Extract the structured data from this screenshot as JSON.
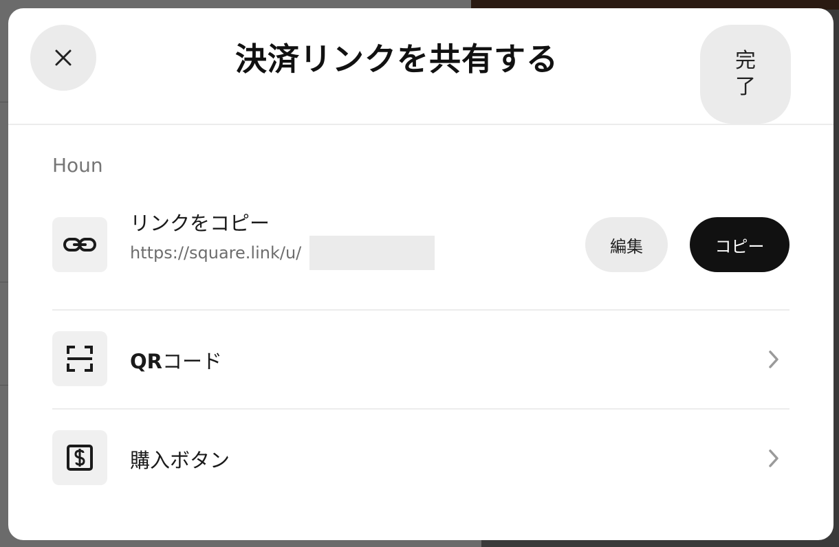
{
  "dialog": {
    "title": "決済リンクを共有する",
    "done_label": "完了",
    "section_label": "Houn"
  },
  "copy_link": {
    "title": "リンクをコピー",
    "url": "https://square.link/u/",
    "edit_label": "編集",
    "copy_label": "コピー"
  },
  "qr_code": {
    "title_prefix": "QR",
    "title_suffix": "コード"
  },
  "buy_button": {
    "title": "購入ボタン"
  },
  "colors": {
    "primary_button": "#111111",
    "secondary_button": "#ebebeb",
    "icon_tile": "#f0f0f0",
    "divider": "#ececec"
  }
}
